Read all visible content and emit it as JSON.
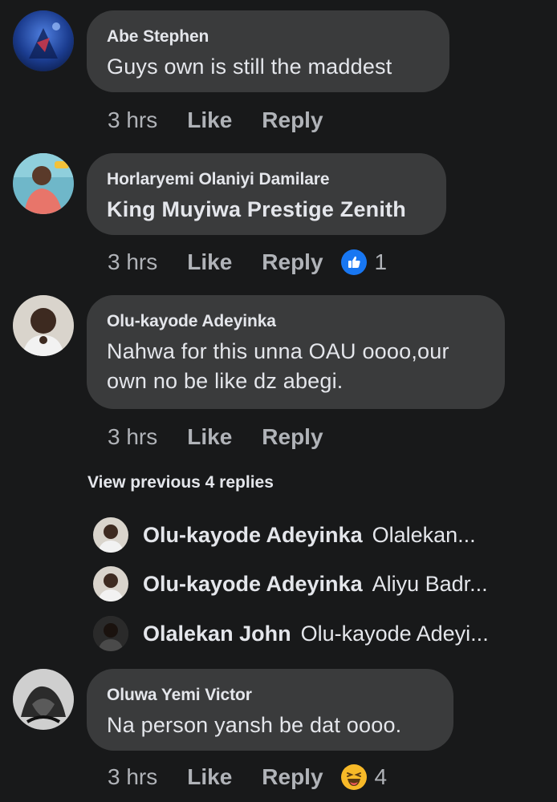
{
  "comments": [
    {
      "author": "Abe Stephen",
      "text": "Guys own is still the maddest",
      "time": "3 hrs",
      "like_label": "Like",
      "reply_label": "Reply"
    },
    {
      "author": "Horlaryemi Olaniyi Damilare",
      "text": "King Muyiwa Prestige Zenith",
      "time": "3 hrs",
      "like_label": "Like",
      "reply_label": "Reply",
      "reaction_icon": "like-thumbs-up-icon",
      "reaction_count": "1"
    },
    {
      "author": "Olu-kayode Adeyinka",
      "text_line1": "Nahwa for this unna OAU oooo,our",
      "text_line2": "own no be like dz abegi.",
      "time": "3 hrs",
      "like_label": "Like",
      "reply_label": "Reply"
    },
    {
      "author": "Oluwa Yemi Victor",
      "text": "Na person yansh be dat oooo.",
      "time": "3 hrs",
      "like_label": "Like",
      "reply_label": "Reply",
      "reaction_icon": "haha-laughing-emoji-icon",
      "reaction_count": "4"
    }
  ],
  "view_previous": "View previous 4 replies",
  "replies": [
    {
      "name": "Olu-kayode Adeyinka",
      "preview": "Olalekan..."
    },
    {
      "name": "Olu-kayode Adeyinka",
      "preview": "Aliyu Badr..."
    },
    {
      "name": "Olalekan John",
      "preview": "Olu-kayode Adeyi..."
    }
  ],
  "colors": {
    "background": "#18191a",
    "bubble": "#3a3b3c",
    "primary_text": "#e4e6eb",
    "secondary_text": "#b0b3b8",
    "like_blue": "#1877f2",
    "haha_yellow": "#f7b928"
  }
}
